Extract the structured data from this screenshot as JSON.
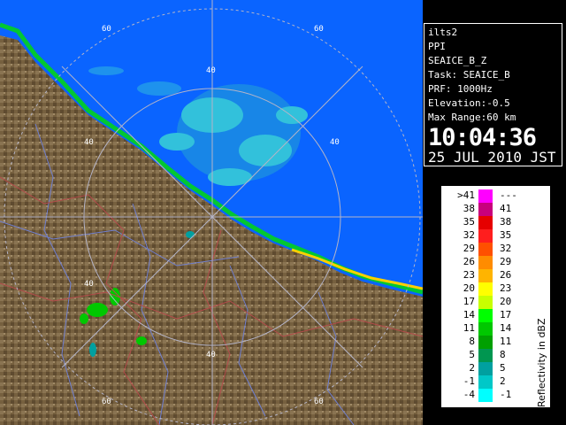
{
  "radar": {
    "site": "ilts2",
    "mode": "PPI",
    "product": "SEAICE_B_Z",
    "task": "Task: SEAICE_B",
    "prf": "PRF: 1000Hz",
    "elevation": "Elevation:-0.5",
    "max_range": "Max Range:60 km",
    "time": "10:04:36",
    "date": "25 JUL 2010 JST"
  },
  "ring_labels": {
    "a": "60",
    "b": "60",
    "c": "40",
    "d": "40",
    "e": "40",
    "f": "40",
    "g": "40",
    "h": "60",
    "i": "60"
  },
  "legend": {
    "title": "Reflectivity in dBZ",
    "rows": [
      {
        "lo": ">41",
        "hi": "---",
        "color": "#ff00ff"
      },
      {
        "lo": "38",
        "hi": "41",
        "color": "#c8007d"
      },
      {
        "lo": "35",
        "hi": "38",
        "color": "#e60000"
      },
      {
        "lo": "32",
        "hi": "35",
        "color": "#ff1e1e"
      },
      {
        "lo": "29",
        "hi": "32",
        "color": "#ff5000"
      },
      {
        "lo": "26",
        "hi": "29",
        "color": "#ff8c00"
      },
      {
        "lo": "23",
        "hi": "26",
        "color": "#ffb400"
      },
      {
        "lo": "20",
        "hi": "23",
        "color": "#ffff00"
      },
      {
        "lo": "17",
        "hi": "20",
        "color": "#c8ff00"
      },
      {
        "lo": "14",
        "hi": "17",
        "color": "#00ff00"
      },
      {
        "lo": "11",
        "hi": "14",
        "color": "#00c800"
      },
      {
        "lo": "8",
        "hi": "11",
        "color": "#00a000"
      },
      {
        "lo": "5",
        "hi": "8",
        "color": "#009650"
      },
      {
        "lo": "2",
        "hi": "5",
        "color": "#00a0a0"
      },
      {
        "lo": "-1",
        "hi": "2",
        "color": "#00c8c8"
      },
      {
        "lo": "-4",
        "hi": "-1",
        "color": "#00ffff"
      }
    ]
  },
  "colors": {
    "sea": "#0a64ff",
    "land": "#7a6446",
    "ring": "#b4b4c8",
    "river": "#6f7fd0",
    "border": "#b44b4b"
  }
}
